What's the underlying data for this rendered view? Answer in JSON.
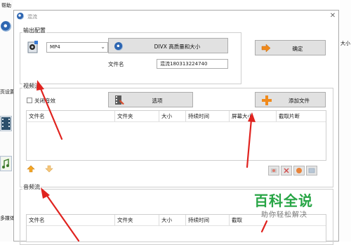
{
  "background": {
    "help_menu": "帮助",
    "left_settings_text": "页设置",
    "left_multi_text": "多媒体",
    "right_size_text": "大小"
  },
  "dialog": {
    "title": "混流",
    "output_group": {
      "label": "输出配置",
      "format_value": "MP4",
      "quality_button": "DIVX 高质量和大小",
      "filename_label": "文件名",
      "filename_value": "混流180313224740",
      "confirm_button": "确定"
    },
    "video_group": {
      "label": "视频流",
      "mute_checkbox": "关闭音效",
      "options_button": "选项",
      "add_file_button": "添加文件",
      "columns": [
        "文件名",
        "文件夹",
        "大小",
        "持续时间",
        "屏幕大小",
        "截取片断"
      ]
    },
    "audio_group": {
      "label": "音频流",
      "columns": [
        "文件名",
        "文件夹",
        "大小",
        "持续时间",
        "截取"
      ]
    }
  },
  "watermark": {
    "title": "百科全说",
    "subtitle": "助你轻松解决"
  },
  "colors": {
    "arrow_red": "#e0231f",
    "watermark_green": "#27a545",
    "add_icon_orange": "#f08a1c"
  }
}
